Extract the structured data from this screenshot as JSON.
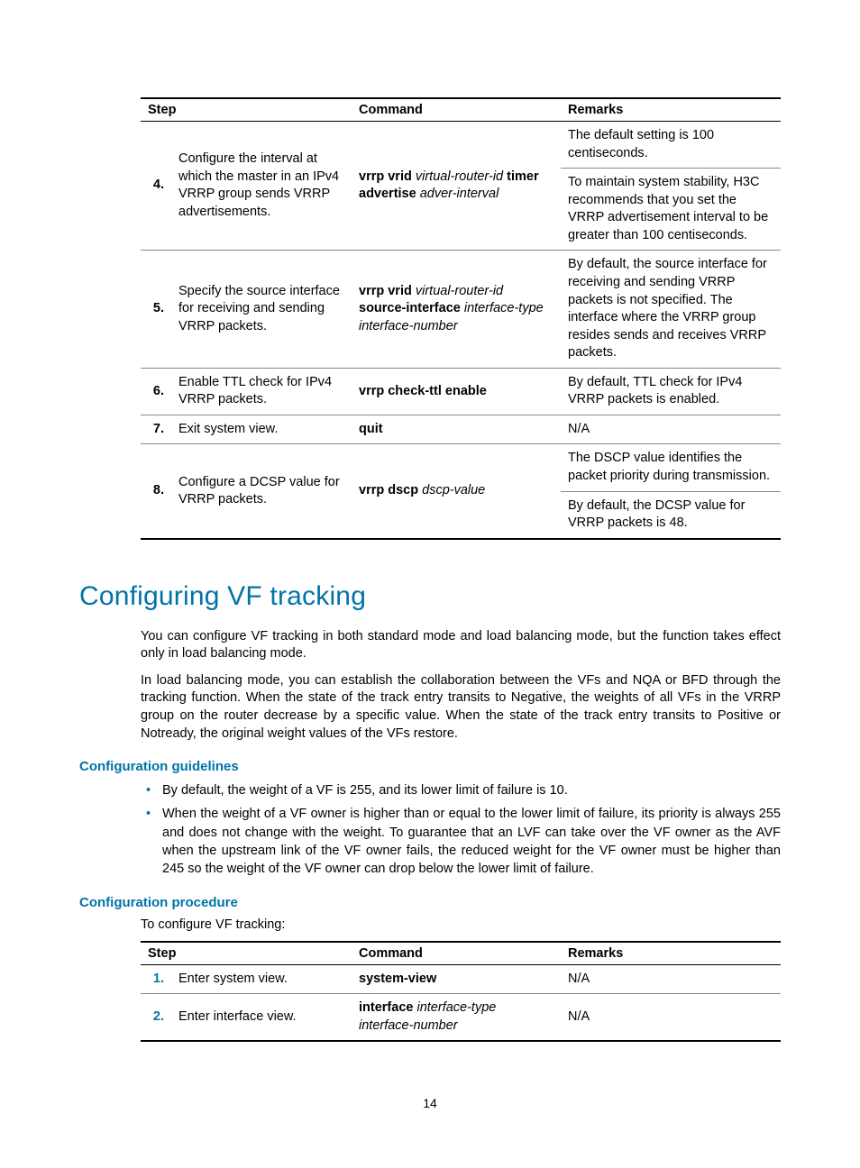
{
  "table1": {
    "headers": {
      "step": "Step",
      "command": "Command",
      "remarks": "Remarks"
    },
    "rows": [
      {
        "num": "4.",
        "step": "Configure the interval at which the master in an IPv4 VRRP group sends VRRP advertisements.",
        "cmd_b1": "vrrp vrid",
        "cmd_i1": "virtual-router-id",
        "cmd_b2": "timer advertise",
        "cmd_i2": "adver-interval",
        "rem_a": "The default setting is 100 centiseconds.",
        "rem_b": "To maintain system stability, H3C recommends that you set the VRRP advertisement interval to be greater than 100 centiseconds."
      },
      {
        "num": "5.",
        "step": "Specify the source interface for receiving and sending VRRP packets.",
        "cmd_b1": "vrrp vrid",
        "cmd_i1": "virtual-router-id",
        "cmd_b2": "source-interface",
        "cmd_i2": "interface-type interface-number",
        "rem": "By default, the source interface for receiving and sending VRRP packets is not specified. The interface where the VRRP group resides sends and receives VRRP packets."
      },
      {
        "num": "6.",
        "step": "Enable TTL check for IPv4 VRRP packets.",
        "cmd_b1": "vrrp check-ttl enable",
        "rem": "By default, TTL check for IPv4 VRRP packets is enabled."
      },
      {
        "num": "7.",
        "step": "Exit system view.",
        "cmd_b1": "quit",
        "rem": "N/A"
      },
      {
        "num": "8.",
        "step": "Configure a DCSP value for VRRP packets.",
        "cmd_b1": "vrrp dscp",
        "cmd_i1": "dscp-value",
        "rem_a": "The DSCP value identifies the packet priority during transmission.",
        "rem_b": "By default, the DCSP value for VRRP packets is 48."
      }
    ]
  },
  "section_title": "Configuring VF tracking",
  "para1": "You can configure VF tracking in both standard mode and load balancing mode, but the function takes effect only in load balancing mode.",
  "para2": "In load balancing mode, you can establish the collaboration between the VFs and NQA or BFD through the tracking function. When the state of the track entry transits to Negative, the weights of all VFs in the VRRP group on the router decrease by a specific value. When the state of the track entry transits to Positive or Notready, the original weight values of the VFs restore.",
  "guidelines_title": "Configuration guidelines",
  "bullet1": "By default, the weight of a VF is 255, and its lower limit of failure is 10.",
  "bullet2": "When the weight of a VF owner is higher than or equal to the lower limit of failure, its priority is always 255 and does not change with the weight. To guarantee that an LVF can take over the VF owner as the AVF when the upstream link of the VF owner fails, the reduced weight for the VF owner must be higher than 245 so the weight of the VF owner can drop below the lower limit of failure.",
  "procedure_title": "Configuration procedure",
  "procedure_intro": "To configure VF tracking:",
  "table2": {
    "headers": {
      "step": "Step",
      "command": "Command",
      "remarks": "Remarks"
    },
    "rows": [
      {
        "num": "1.",
        "step": "Enter system view.",
        "cmd_b1": "system-view",
        "rem": "N/A"
      },
      {
        "num": "2.",
        "step": "Enter interface view.",
        "cmd_b1": "interface",
        "cmd_i1": "interface-type interface-number",
        "rem": "N/A"
      }
    ]
  },
  "page_number": "14"
}
